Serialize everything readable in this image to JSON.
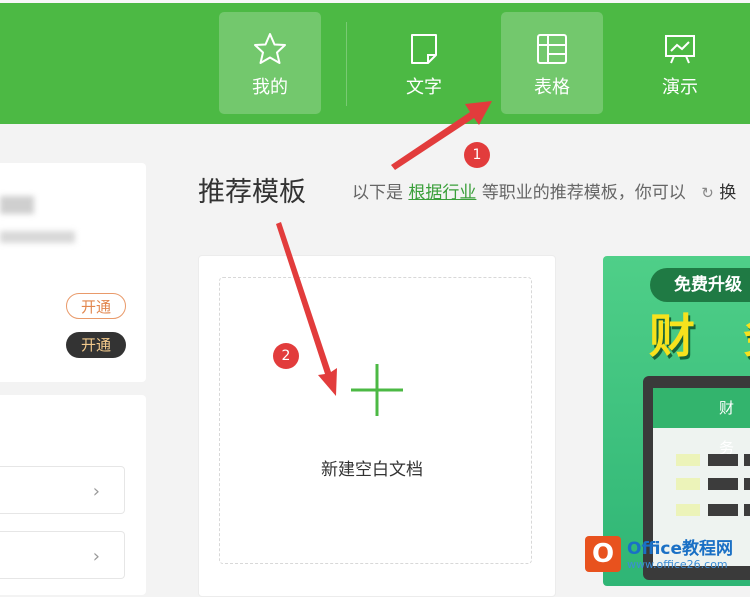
{
  "nav": {
    "items": [
      {
        "label": "我的",
        "icon": "star-icon"
      },
      {
        "label": "文字",
        "icon": "document-icon"
      },
      {
        "label": "表格",
        "icon": "spreadsheet-icon"
      },
      {
        "label": "演示",
        "icon": "presentation-icon"
      }
    ]
  },
  "left": {
    "pill_outline": "开通",
    "pill_dark": "开通",
    "chevron": "›"
  },
  "main": {
    "title": "推荐模板",
    "subtitle_prefix": "以下是",
    "subtitle_link": "根据行业",
    "subtitle_middle": "等职业的推荐模板，你可以",
    "subtitle_tail": "换",
    "new_blank": "新建空白文档"
  },
  "promo": {
    "badge": "免费升级",
    "big_text": "财 务",
    "screen_title": "财 务"
  },
  "annotations": {
    "step1": "1",
    "step2": "2"
  },
  "watermark": {
    "logo_letter": "O",
    "title": "Office教程网",
    "url": "www.office26.com"
  },
  "colors": {
    "brand_green": "#4cb944",
    "annotation_red": "#e23c3c",
    "link_green": "#3a9f3a"
  }
}
